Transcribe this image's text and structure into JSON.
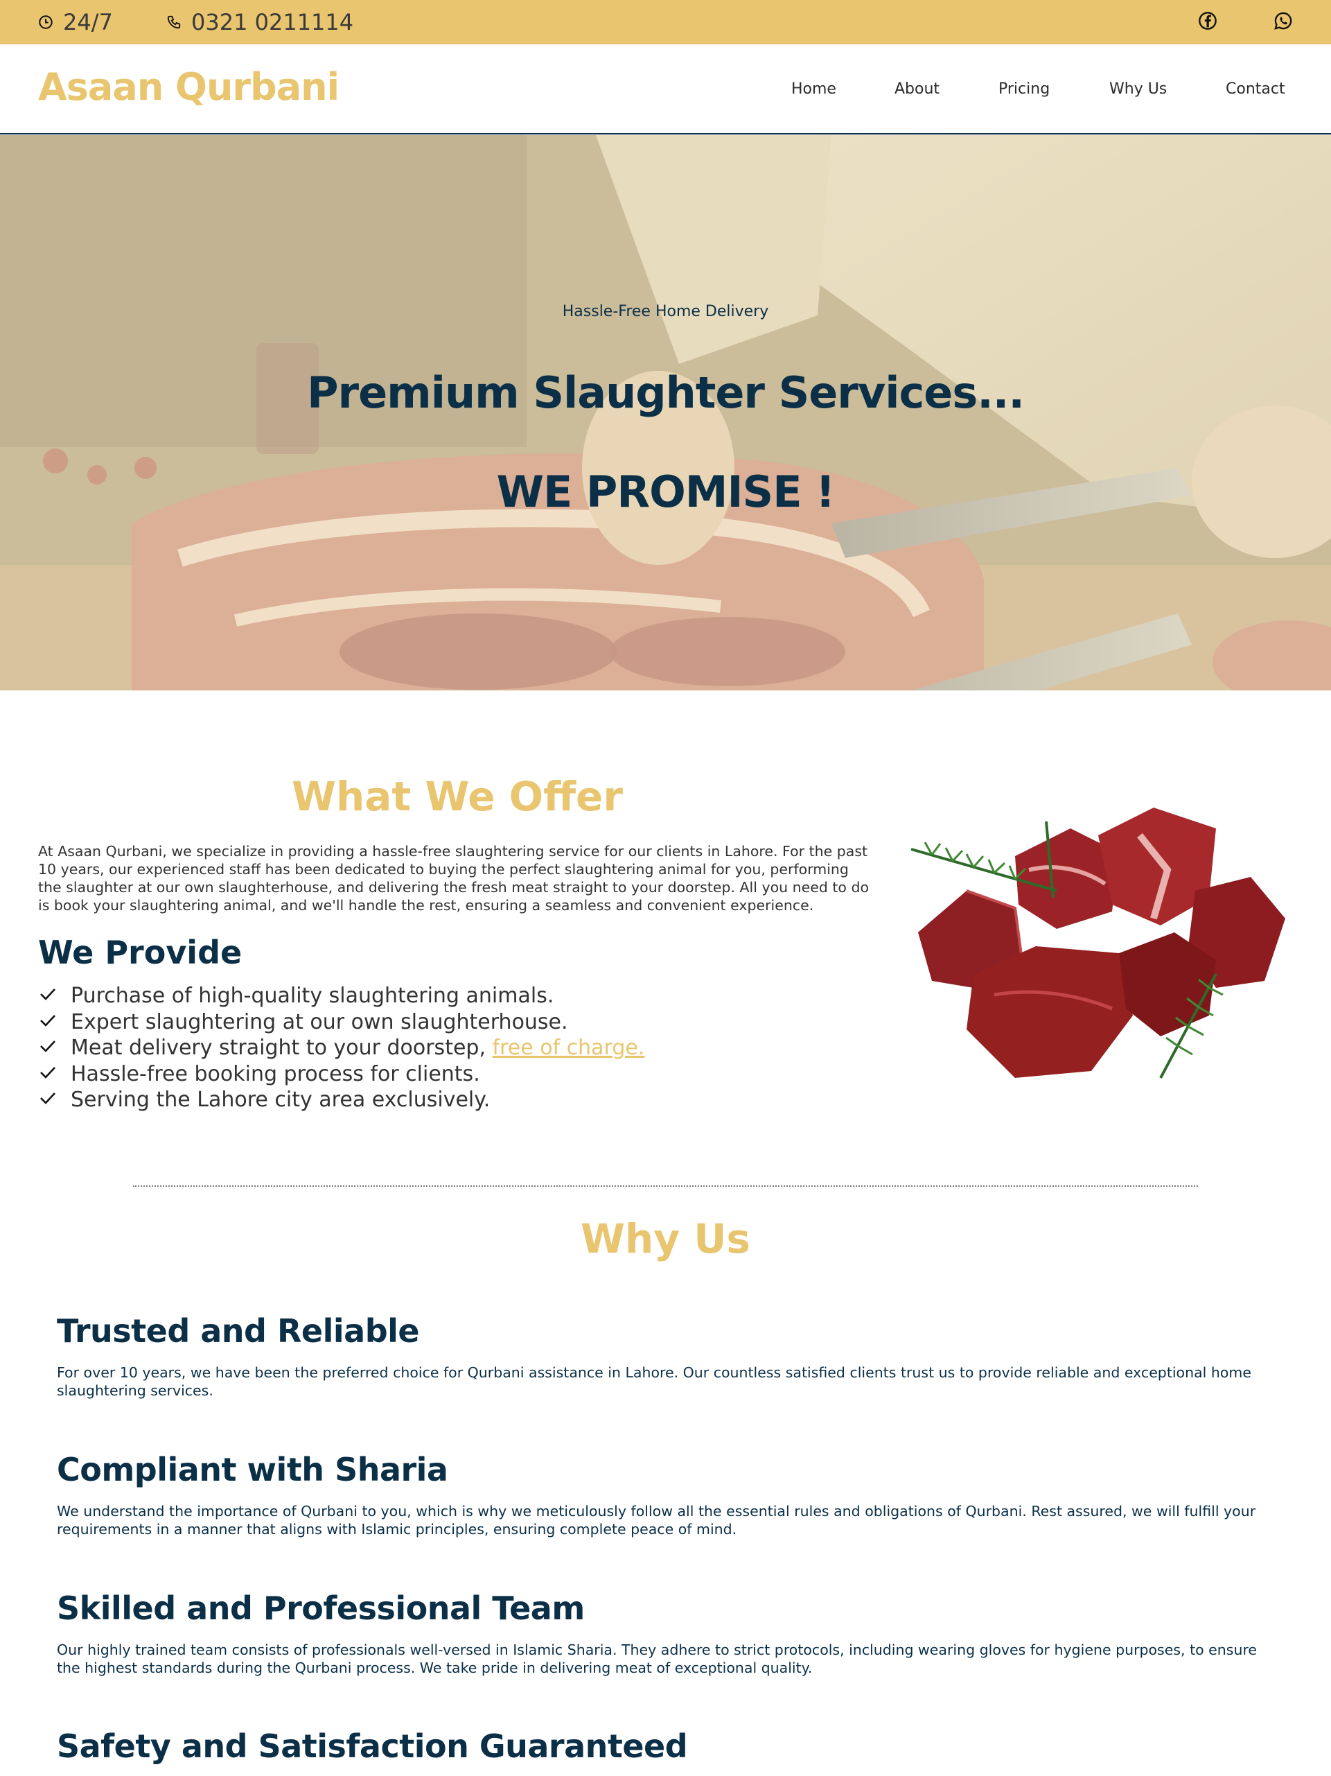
{
  "topbar": {
    "hours": "24/7",
    "phone": "0321 0211114",
    "social": [
      "facebook-icon",
      "whatsapp-icon"
    ],
    "color": "#e8c56e"
  },
  "header": {
    "logo": "Asaan Qurbani",
    "nav": [
      "Home",
      "About",
      "Pricing",
      "Why Us",
      "Contact"
    ]
  },
  "hero": {
    "subtitle": "Hassle-Free Home Delivery",
    "title": "Premium Slaughter Services...",
    "promise": "WE PROMISE !"
  },
  "offer": {
    "title": "What We Offer",
    "text": "At Asaan Qurbani, we specialize in providing a hassle-free slaughtering service for our clients in Lahore. For the past 10 years, our experienced staff has been dedicated to buying the perfect slaughtering animal for you, performing the slaughter at our own slaughterhouse, and delivering the fresh meat straight to your doorstep. All you need to do is book your slaughtering animal, and we'll handle the rest, ensuring a seamless and convenient experience.",
    "provide_title": "We Provide",
    "provide": [
      "Purchase of high-quality slaughtering animals.",
      "Expert slaughtering at our own slaughterhouse.",
      "Meat delivery straight to your doorstep, ",
      "Hassle-free booking process for clients.",
      "Serving the Lahore city area exclusively."
    ],
    "free_link": "free of charge."
  },
  "why": {
    "title": "Why Us",
    "items": [
      {
        "heading": "Trusted and Reliable",
        "text": "For over 10 years, we have been the preferred choice for Qurbani assistance in Lahore. Our countless satisfied clients trust us to provide reliable and exceptional home slaughtering services."
      },
      {
        "heading": "Compliant with Sharia",
        "text": "We understand the importance of Qurbani to you, which is why we meticulously follow all the essential rules and obligations of Qurbani. Rest assured, we will fulfill your requirements in a manner that aligns with Islamic principles, ensuring complete peace of mind."
      },
      {
        "heading": "Skilled and Professional Team",
        "text": "Our highly trained team consists of professionals well-versed in Islamic Sharia. They adhere to strict protocols, including wearing gloves for hygiene purposes, to ensure the highest standards during the Qurbani process. We take pride in delivering meat of exceptional quality."
      },
      {
        "heading": "Safety and Satisfaction Guaranteed",
        "text": ""
      }
    ]
  }
}
